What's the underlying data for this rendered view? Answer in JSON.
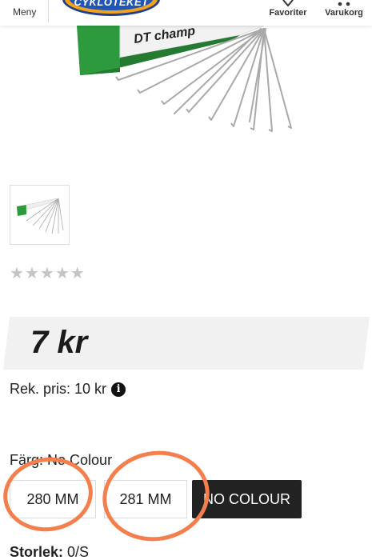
{
  "header": {
    "menu_label": "Meny",
    "logo_text": "CYKLOTEKET",
    "favorites_label": "Favoriter",
    "cart_label": "Varukorg"
  },
  "product_image": {
    "brand_text": "DT champ"
  },
  "rating": {
    "stars_filled": 0,
    "stars_total": 5
  },
  "price": {
    "display": "7 kr"
  },
  "rek_pris": {
    "label": "Rek. pris: 10 kr"
  },
  "attributes": {
    "farg_label": "Färg:",
    "farg_value": "No Colour",
    "storlek_label": "Storlek:",
    "storlek_value": "0/S"
  },
  "options": [
    {
      "label": "280 MM",
      "selected": false
    },
    {
      "label": "281 MM",
      "selected": false
    },
    {
      "label": "NO COLOUR",
      "selected": true
    }
  ],
  "colors": {
    "accent_orange": "#f47e4c",
    "box_green": "#2e9a3e",
    "selected_dark": "#222222"
  }
}
